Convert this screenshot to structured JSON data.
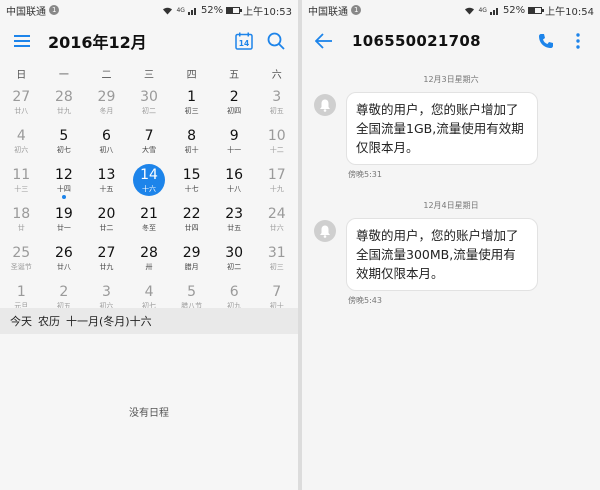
{
  "calendar": {
    "status": {
      "carrier": "中国联通",
      "sim": "1",
      "signal": "4G",
      "battery": "52%",
      "battery_level": 0.52,
      "time": "上午10:53"
    },
    "title": "2016年12月",
    "today_icon_label": "14",
    "weekdays": [
      "日",
      "一",
      "二",
      "三",
      "四",
      "五",
      "六"
    ],
    "weeks": [
      [
        {
          "d": "27",
          "l": "廿八",
          "dim": true
        },
        {
          "d": "28",
          "l": "廿九",
          "dim": true
        },
        {
          "d": "29",
          "l": "冬月",
          "dim": true
        },
        {
          "d": "30",
          "l": "初二",
          "dim": true
        },
        {
          "d": "1",
          "l": "初三"
        },
        {
          "d": "2",
          "l": "初四"
        },
        {
          "d": "3",
          "l": "初五",
          "dim": true
        }
      ],
      [
        {
          "d": "4",
          "l": "初六",
          "dim": true
        },
        {
          "d": "5",
          "l": "初七"
        },
        {
          "d": "6",
          "l": "初八"
        },
        {
          "d": "7",
          "l": "大雪"
        },
        {
          "d": "8",
          "l": "初十"
        },
        {
          "d": "9",
          "l": "十一"
        },
        {
          "d": "10",
          "l": "十二",
          "dim": true
        }
      ],
      [
        {
          "d": "11",
          "l": "十三",
          "dim": true
        },
        {
          "d": "12",
          "l": "十四",
          "dot": true
        },
        {
          "d": "13",
          "l": "十五"
        },
        {
          "d": "14",
          "l": "十六",
          "sel": true
        },
        {
          "d": "15",
          "l": "十七"
        },
        {
          "d": "16",
          "l": "十八"
        },
        {
          "d": "17",
          "l": "十九",
          "dim": true
        }
      ],
      [
        {
          "d": "18",
          "l": "廿",
          "dim": true
        },
        {
          "d": "19",
          "l": "廿一"
        },
        {
          "d": "20",
          "l": "廿二"
        },
        {
          "d": "21",
          "l": "冬至"
        },
        {
          "d": "22",
          "l": "廿四"
        },
        {
          "d": "23",
          "l": "廿五"
        },
        {
          "d": "24",
          "l": "廿六",
          "dim": true
        }
      ],
      [
        {
          "d": "25",
          "l": "圣诞节",
          "dim": true
        },
        {
          "d": "26",
          "l": "廿八"
        },
        {
          "d": "27",
          "l": "廿九"
        },
        {
          "d": "28",
          "l": "卅"
        },
        {
          "d": "29",
          "l": "腊月"
        },
        {
          "d": "30",
          "l": "初二"
        },
        {
          "d": "31",
          "l": "初三",
          "dim": true
        }
      ],
      [
        {
          "d": "1",
          "l": "元旦",
          "dim": true
        },
        {
          "d": "2",
          "l": "初五",
          "dim": true
        },
        {
          "d": "3",
          "l": "初六",
          "dim": true
        },
        {
          "d": "4",
          "l": "初七",
          "dim": true
        },
        {
          "d": "5",
          "l": "腊八节",
          "dim": true
        },
        {
          "d": "6",
          "l": "初九",
          "dim": true
        },
        {
          "d": "7",
          "l": "初十",
          "dim": true
        }
      ]
    ],
    "today_label": "今天",
    "lunar_label": "农历",
    "lunar_date": "十一月(冬月)十六",
    "empty_text": "没有日程"
  },
  "sms": {
    "status": {
      "carrier": "中国联通",
      "sim": "1",
      "signal": "4G",
      "battery": "52%",
      "battery_level": 0.52,
      "time": "上午10:54"
    },
    "title": "106550021708",
    "messages": [
      {
        "date": "12月3日星期六",
        "text": "尊敬的用户，您的账户增加了全国流量1GB,流量使用有效期仅限本月。",
        "time": "傍晚5:31"
      },
      {
        "date": "12月4日星期日",
        "text": "尊敬的用户，您的账户增加了全国流量300MB,流量使用有效期仅限本月。",
        "time": "傍晚5:43"
      }
    ]
  },
  "colors": {
    "accent": "#1d84ea",
    "today_bar": "#e9e9e9"
  }
}
